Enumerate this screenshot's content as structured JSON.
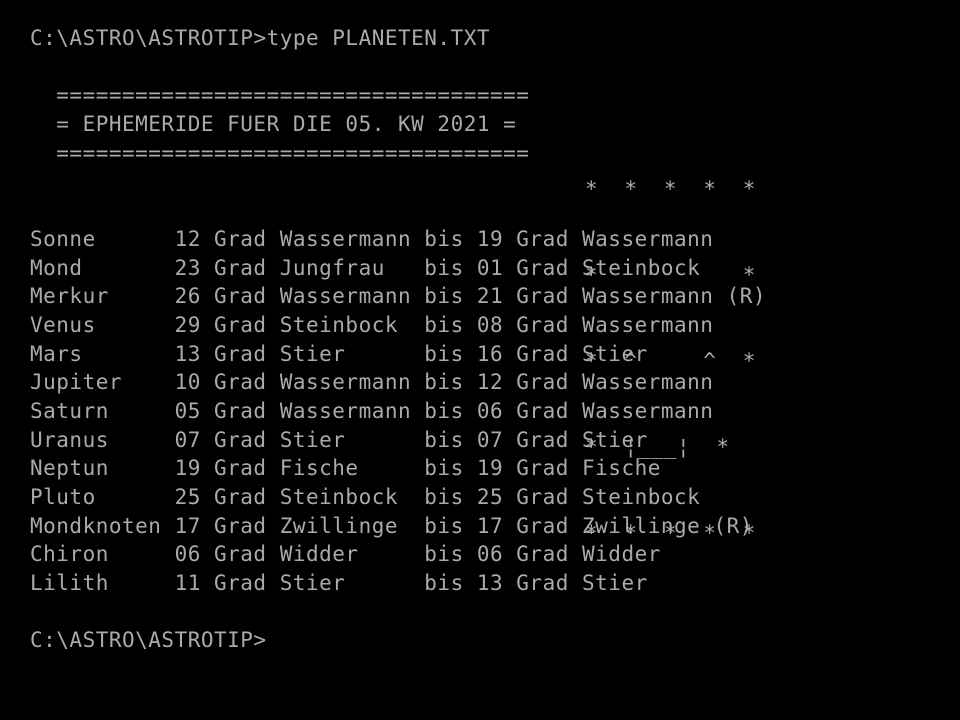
{
  "terminal": {
    "colors": {
      "background": "#000000",
      "foreground": "#aaaaaa"
    },
    "command_prompt_line": "C:\\ASTRO\\ASTROTIP>type PLANETEN.TXT",
    "final_prompt": "C:\\ASTRO\\ASTROTIP>",
    "prompt_path": "C:\\ASTRO\\ASTROTIP>",
    "command": "type PLANETEN.TXT",
    "filename": "PLANETEN.TXT"
  },
  "header": {
    "border_top": "  ====================================",
    "title_line": "  = EPHEMERIDE FUER DIE 05. KW 2021 =",
    "border_bottom": "  ====================================",
    "title_text": "EPHEMERIDE FUER DIE 05. KW 2021",
    "calendar_week": "05",
    "year": "2021"
  },
  "ascii_art": {
    "name": "star-frame-rocket-art",
    "rows": [
      "*  *  *  *  *",
      "*           *",
      "*  ^     ^  *",
      "*  ¦___¦  *",
      "*  *  *  *  *"
    ],
    "row_1": "*  *  *  *  *",
    "row_2": "*           *",
    "row_3": "*  ^     ^  *",
    "row_4": "*  ¦___¦  *",
    "row_5": "*  *  *  *  *"
  },
  "table": {
    "separator_word": "bis",
    "degree_word": "Grad",
    "retrograde_marker": "(R)",
    "rows": [
      {
        "body": "Sonne",
        "start_degree": "12",
        "start_unit": "Grad",
        "start_sign": "Wassermann",
        "separator": "bis",
        "end_degree": "19",
        "end_unit": "Grad",
        "end_sign": "Wassermann",
        "retrograde": "",
        "line": "Sonne      12 Grad Wassermann bis 19 Grad Wassermann"
      },
      {
        "body": "Mond",
        "start_degree": "23",
        "start_unit": "Grad",
        "start_sign": "Jungfrau",
        "separator": "bis",
        "end_degree": "01",
        "end_unit": "Grad",
        "end_sign": "Steinbock",
        "retrograde": "",
        "line": "Mond       23 Grad Jungfrau   bis 01 Grad Steinbock"
      },
      {
        "body": "Merkur",
        "start_degree": "26",
        "start_unit": "Grad",
        "start_sign": "Wassermann",
        "separator": "bis",
        "end_degree": "21",
        "end_unit": "Grad",
        "end_sign": "Wassermann",
        "retrograde": "(R)",
        "line": "Merkur     26 Grad Wassermann bis 21 Grad Wassermann (R)"
      },
      {
        "body": "Venus",
        "start_degree": "29",
        "start_unit": "Grad",
        "start_sign": "Steinbock",
        "separator": "bis",
        "end_degree": "08",
        "end_unit": "Grad",
        "end_sign": "Wassermann",
        "retrograde": "",
        "line": "Venus      29 Grad Steinbock  bis 08 Grad Wassermann"
      },
      {
        "body": "Mars",
        "start_degree": "13",
        "start_unit": "Grad",
        "start_sign": "Stier",
        "separator": "bis",
        "end_degree": "16",
        "end_unit": "Grad",
        "end_sign": "Stier",
        "retrograde": "",
        "line": "Mars       13 Grad Stier      bis 16 Grad Stier"
      },
      {
        "body": "Jupiter",
        "start_degree": "10",
        "start_unit": "Grad",
        "start_sign": "Wassermann",
        "separator": "bis",
        "end_degree": "12",
        "end_unit": "Grad",
        "end_sign": "Wassermann",
        "retrograde": "",
        "line": "Jupiter    10 Grad Wassermann bis 12 Grad Wassermann"
      },
      {
        "body": "Saturn",
        "start_degree": "05",
        "start_unit": "Grad",
        "start_sign": "Wassermann",
        "separator": "bis",
        "end_degree": "06",
        "end_unit": "Grad",
        "end_sign": "Wassermann",
        "retrograde": "",
        "line": "Saturn     05 Grad Wassermann bis 06 Grad Wassermann"
      },
      {
        "body": "Uranus",
        "start_degree": "07",
        "start_unit": "Grad",
        "start_sign": "Stier",
        "separator": "bis",
        "end_degree": "07",
        "end_unit": "Grad",
        "end_sign": "Stier",
        "retrograde": "",
        "line": "Uranus     07 Grad Stier      bis 07 Grad Stier"
      },
      {
        "body": "Neptun",
        "start_degree": "19",
        "start_unit": "Grad",
        "start_sign": "Fische",
        "separator": "bis",
        "end_degree": "19",
        "end_unit": "Grad",
        "end_sign": "Fische",
        "retrograde": "",
        "line": "Neptun     19 Grad Fische     bis 19 Grad Fische"
      },
      {
        "body": "Pluto",
        "start_degree": "25",
        "start_unit": "Grad",
        "start_sign": "Steinbock",
        "separator": "bis",
        "end_degree": "25",
        "end_unit": "Grad",
        "end_sign": "Steinbock",
        "retrograde": "",
        "line": "Pluto      25 Grad Steinbock  bis 25 Grad Steinbock"
      },
      {
        "body": "Mondknoten",
        "start_degree": "17",
        "start_unit": "Grad",
        "start_sign": "Zwillinge",
        "separator": "bis",
        "end_degree": "17",
        "end_unit": "Grad",
        "end_sign": "Zwillinge",
        "retrograde": "(R)",
        "line": "Mondknoten 17 Grad Zwillinge  bis 17 Grad Zwillinge (R)"
      },
      {
        "body": "Chiron",
        "start_degree": "06",
        "start_unit": "Grad",
        "start_sign": "Widder",
        "separator": "bis",
        "end_degree": "06",
        "end_unit": "Grad",
        "end_sign": "Widder",
        "retrograde": "",
        "line": "Chiron     06 Grad Widder     bis 06 Grad Widder"
      },
      {
        "body": "Lilith",
        "start_degree": "11",
        "start_unit": "Grad",
        "start_sign": "Stier",
        "separator": "bis",
        "end_degree": "13",
        "end_unit": "Grad",
        "end_sign": "Stier",
        "retrograde": "",
        "line": "Lilith     11 Grad Stier      bis 13 Grad Stier"
      }
    ]
  }
}
